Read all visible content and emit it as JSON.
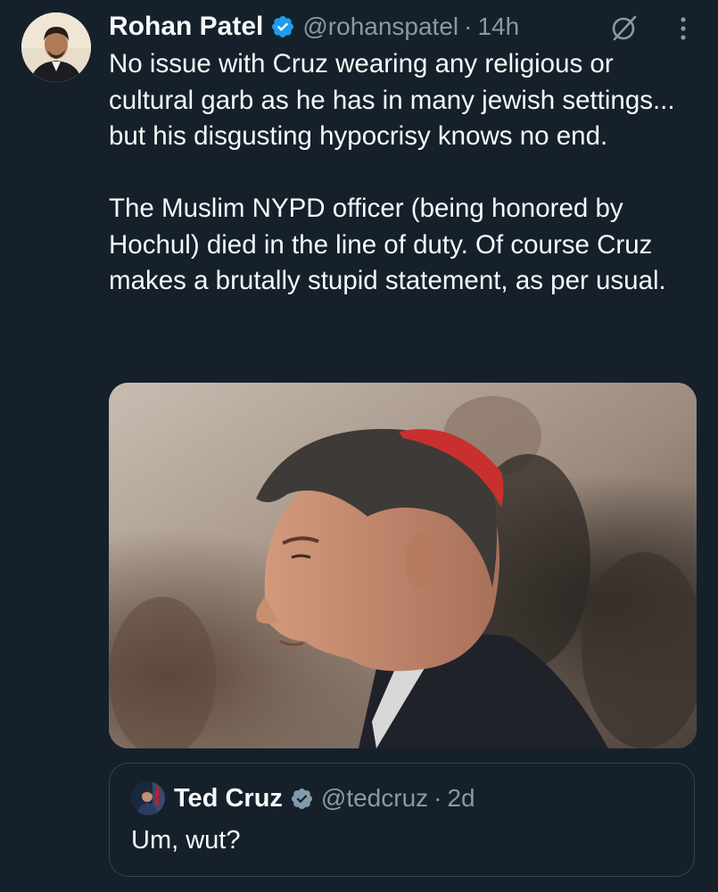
{
  "tweet": {
    "display_name": "Rohan Patel",
    "handle": "@rohanspatel",
    "separator": "·",
    "time": "14h",
    "paragraphs": [
      "No issue with Cruz wearing any religious or cultural garb as he has in many jewish settings... but his disgusting hypocrisy knows no end.",
      "The Muslim NYPD officer (being honored by Hochul) died in the line of duty. Of course Cruz makes a brutally stupid statement, as per usual."
    ],
    "icons": {
      "verified": "verified-badge-icon",
      "grok": "grok-icon",
      "more": "more-icon"
    }
  },
  "quoted_tweet": {
    "display_name": "Ted Cruz",
    "handle": "@tedcruz",
    "separator": "·",
    "time": "2d",
    "text": "Um, wut?"
  },
  "colors": {
    "background": "#15202b",
    "primary_text": "#f7f9f9",
    "secondary_text": "#8b98a5",
    "verified": "#1d9bf0",
    "border": "#38444d"
  }
}
